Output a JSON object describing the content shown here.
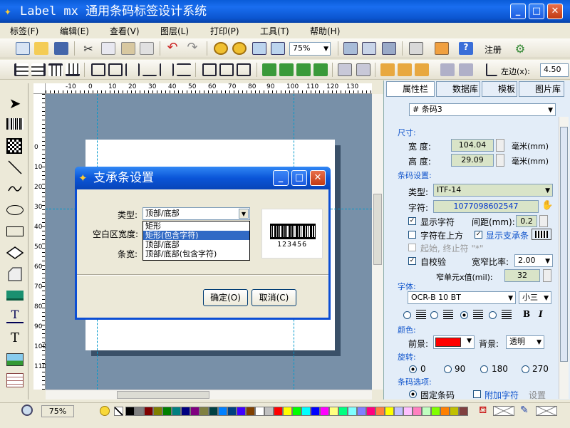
{
  "window": {
    "title": "Label mx 通用条码标签设计系统"
  },
  "menu": [
    "标签(F)",
    "编辑(E)",
    "查看(V)",
    "图层(L)",
    "打印(P)",
    "工具(T)",
    "帮助(H)"
  ],
  "toolbar": {
    "zoom": "75%",
    "left_label": "左边(x):",
    "left_value": "4.50"
  },
  "right_tabs": [
    "属性栏",
    "数据库",
    "模板",
    "图片库"
  ],
  "object_select": "# 条码3",
  "size": {
    "title": "尺寸:",
    "width_label": "宽  度:",
    "width": "104.04",
    "height_label": "高  度:",
    "height": "29.09",
    "unit": "毫米(mm)"
  },
  "barcode": {
    "title": "条码设置:",
    "type_label": "类型:",
    "type": "ITF-14",
    "chars_label": "字符:",
    "chars": "1077098602547",
    "show_chars": "显示字符",
    "spacing_label": "间距(mm):",
    "spacing": "0.2",
    "chars_top": "字符在上方",
    "show_bearer": "显示支承条",
    "start_stop": "起始, 终止符 \"*\"",
    "checksum": "自校验",
    "ratio_label": "宽窄比率:",
    "ratio": "2.00",
    "narrow_label": "窄单元x值(mil):",
    "narrow": "32"
  },
  "font": {
    "title": "字体:",
    "name": "OCR-B 10 BT",
    "size": "小三",
    "bold": "B",
    "italic": "I"
  },
  "color": {
    "title": "颜色:",
    "fg_label": "前景:",
    "fg": "#ff0000",
    "bg_label": "背景:",
    "bg": "透明"
  },
  "rotate": {
    "title": "旋转:",
    "options": [
      "0",
      "90",
      "180",
      "270"
    ]
  },
  "barcode_opts": {
    "title": "条码选项:",
    "fixed": "固定条码",
    "add_char": "附加字符",
    "settings": "设置"
  },
  "dialog": {
    "title": "支承条设置",
    "type_label": "类型:",
    "type_value": "顶部/底部",
    "quiet_label": "空白区宽度:",
    "bar_label": "条宽:",
    "options": [
      "矩形",
      "矩形(包含字符)",
      "顶部/底部",
      "顶部/底部(包含字符)"
    ],
    "selected_index": 1,
    "preview_digits": "123456",
    "ok": "确定(O)",
    "cancel": "取消(C)"
  },
  "status": {
    "zoom": "75%"
  },
  "ruler_h": [
    "-10",
    "0",
    "10",
    "20",
    "30",
    "40",
    "50",
    "60",
    "70",
    "80",
    "90",
    "100",
    "110",
    "120",
    "130"
  ],
  "ruler_v": [
    "0",
    "10",
    "20",
    "30",
    "40",
    "50",
    "60",
    "70",
    "80",
    "90",
    "100",
    "110"
  ],
  "palette": [
    "#000000",
    "#808080",
    "#800000",
    "#808000",
    "#008000",
    "#008080",
    "#000080",
    "#800080",
    "#808040",
    "#004040",
    "#0080ff",
    "#004080",
    "#4000ff",
    "#804000",
    "#ffffff",
    "#c0c0c0",
    "#ff0000",
    "#ffff00",
    "#00ff00",
    "#00ffff",
    "#0000ff",
    "#ff00ff",
    "#ffff80",
    "#00ff80",
    "#80ffff",
    "#8080ff",
    "#ff0080",
    "#ff8040",
    "#ffff00",
    "#c0c0ff",
    "#ffc0ff",
    "#ff80c0",
    "#c0ffc0",
    "#80ff00",
    "#ff8000",
    "#c0c000",
    "#804040"
  ]
}
